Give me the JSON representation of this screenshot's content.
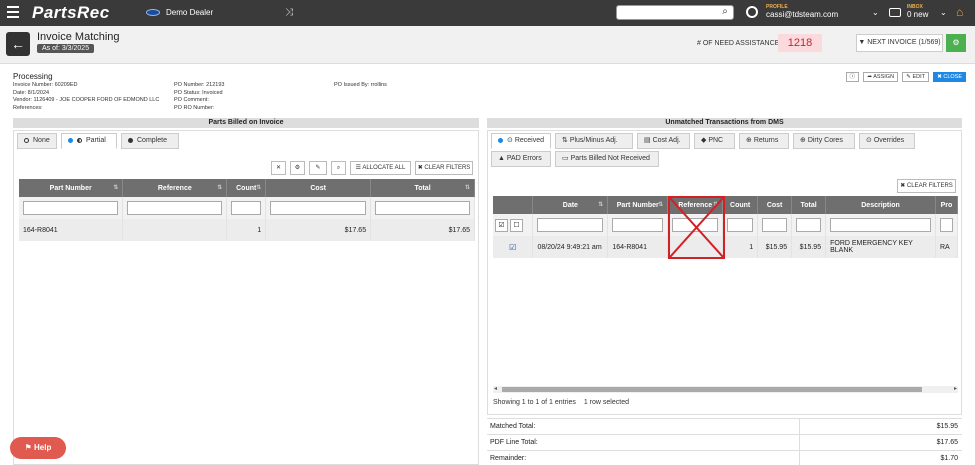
{
  "app": {
    "brand": "PartsRec",
    "dealer": "Demo Dealer"
  },
  "profile": {
    "label": "PROFILE",
    "email": "cassi@tdsteam.com"
  },
  "inbox": {
    "label": "INBOX",
    "count": "0 new"
  },
  "header": {
    "title": "Invoice Matching",
    "as_of": "As of: 3/3/2025",
    "need_assistance_label": "# OF NEED ASSISTANCE:",
    "need_assistance_value": "1218",
    "next_invoice_label": "NEXT INVOICE (1/569)"
  },
  "invoice": {
    "status": "Processing",
    "invoice_number": "Invoice Number: 60209ED",
    "date": "Date: 8/1/2024",
    "vendor": "Vendor: 1126409 - JOE COOPER FORD OF EDMOND LLC",
    "references": "References:",
    "po_number": "PO Number: 212193",
    "po_status": "PO Status: Invoiced",
    "po_comment": "PO Comment:",
    "po_ro_number": "PO RO Number:",
    "po_issued_by": "PO Issued By: rrollins"
  },
  "actions": {
    "assign": "ASSIGN",
    "edit": "EDIT",
    "close": "CLOSE"
  },
  "left": {
    "section_title": "Parts Billed on Invoice",
    "tabs": [
      "None",
      "Partial",
      "Complete"
    ],
    "allocate_all": "ALLOCATE ALL",
    "clear_filters": "CLEAR FILTERS",
    "columns": [
      "Part Number",
      "Reference",
      "Count",
      "Cost",
      "Total"
    ],
    "rows": [
      {
        "part_number": "164-R8041",
        "reference": "",
        "count": "1",
        "cost": "$17.65",
        "total": "$17.65"
      }
    ]
  },
  "right": {
    "section_title": "Unmatched Transactions from DMS",
    "tabs": [
      "Received",
      "Plus/Minus Adj.",
      "Cost Adj.",
      "PNC",
      "Returns",
      "Dirty Cores",
      "Overrides",
      "PAD Errors",
      "Parts Billed Not Received"
    ],
    "clear_filters": "CLEAR FILTERS",
    "columns": [
      "Date",
      "Part Number",
      "Reference",
      "Count",
      "Cost",
      "Total",
      "Description",
      "Pro"
    ],
    "rows": [
      {
        "date": "08/20/24 9:49:21 am",
        "part_number": "164-R8041",
        "reference": "",
        "count": "1",
        "cost": "$15.95",
        "total": "$15.95",
        "description": "FORD EMERGENCY KEY BLANK",
        "pro": "RA"
      }
    ],
    "showing": "Showing 1 to 1 of 1 entries",
    "selected": "1 row selected"
  },
  "totals": {
    "matched_label": "Matched Total:",
    "matched_value": "$15.95",
    "pdf_label": "PDF Line Total:",
    "pdf_value": "$17.65",
    "remainder_label": "Remainder:",
    "remainder_value": "$1.70"
  },
  "help": {
    "label": "Help"
  },
  "colors": {
    "accent_blue": "#1e88e5",
    "need_red": "#c1272d",
    "green": "#4caf50",
    "nav": "#3a3a3a"
  }
}
